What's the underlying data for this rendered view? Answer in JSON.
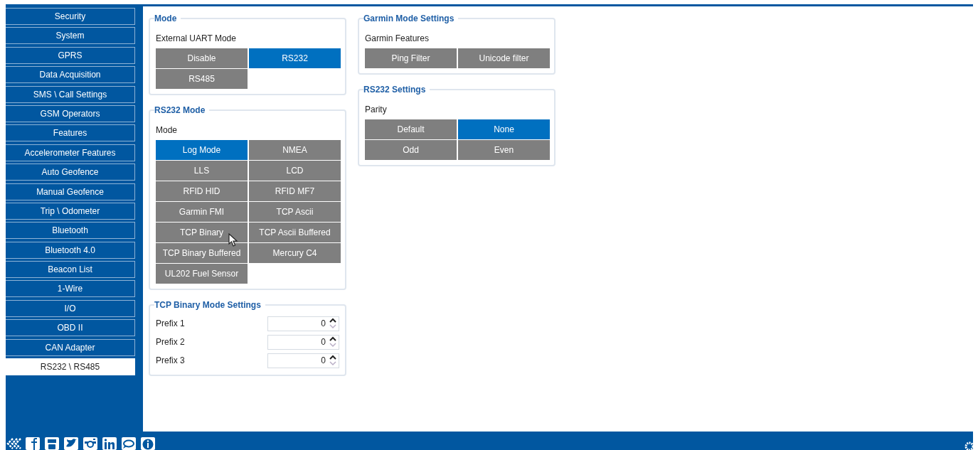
{
  "sidebar": {
    "items": [
      {
        "label": "Security",
        "selected": false
      },
      {
        "label": "System",
        "selected": false
      },
      {
        "label": "GPRS",
        "selected": false
      },
      {
        "label": "Data Acquisition",
        "selected": false
      },
      {
        "label": "SMS \\ Call Settings",
        "selected": false
      },
      {
        "label": "GSM Operators",
        "selected": false
      },
      {
        "label": "Features",
        "selected": false
      },
      {
        "label": "Accelerometer Features",
        "selected": false
      },
      {
        "label": "Auto Geofence",
        "selected": false
      },
      {
        "label": "Manual Geofence",
        "selected": false
      },
      {
        "label": "Trip \\ Odometer",
        "selected": false
      },
      {
        "label": "Bluetooth",
        "selected": false
      },
      {
        "label": "Bluetooth 4.0",
        "selected": false
      },
      {
        "label": "Beacon List",
        "selected": false
      },
      {
        "label": "1-Wire",
        "selected": false
      },
      {
        "label": "I/O",
        "selected": false
      },
      {
        "label": "OBD II",
        "selected": false
      },
      {
        "label": "CAN Adapter",
        "selected": false
      },
      {
        "label": "RS232 \\ RS485",
        "selected": true
      }
    ]
  },
  "left_column": [
    {
      "kind": "options",
      "title": "Mode",
      "label": "External UART Mode",
      "options": [
        {
          "label": "Disable",
          "selected": false
        },
        {
          "label": "RS232",
          "selected": true
        },
        {
          "label": "RS485",
          "selected": false
        }
      ]
    },
    {
      "kind": "options",
      "title": "RS232 Mode",
      "label": "Mode",
      "options": [
        {
          "label": "Log Mode",
          "selected": true
        },
        {
          "label": "NMEA",
          "selected": false
        },
        {
          "label": "LLS",
          "selected": false
        },
        {
          "label": "LCD",
          "selected": false
        },
        {
          "label": "RFID HID",
          "selected": false
        },
        {
          "label": "RFID MF7",
          "selected": false
        },
        {
          "label": "Garmin FMI",
          "selected": false
        },
        {
          "label": "TCP Ascii",
          "selected": false
        },
        {
          "label": "TCP Binary",
          "selected": false
        },
        {
          "label": "TCP Ascii Buffered",
          "selected": false
        },
        {
          "label": "TCP Binary Buffered",
          "selected": false
        },
        {
          "label": "Mercury C4",
          "selected": false
        },
        {
          "label": "UL202 Fuel Sensor",
          "selected": false
        }
      ]
    },
    {
      "kind": "numbers",
      "title": "TCP Binary Mode Settings",
      "fields": [
        {
          "label": "Prefix 1",
          "value": "0"
        },
        {
          "label": "Prefix 2",
          "value": "0"
        },
        {
          "label": "Prefix 3",
          "value": "0"
        }
      ]
    }
  ],
  "right_column": [
    {
      "kind": "options",
      "title": "Garmin Mode Settings",
      "label": "Garmin Features",
      "options": [
        {
          "label": "Ping Filter",
          "selected": false
        },
        {
          "label": "Unicode filter",
          "selected": false
        }
      ]
    },
    {
      "kind": "options",
      "title": "RS232 Settings",
      "label": "Parity",
      "options": [
        {
          "label": "Default",
          "selected": false
        },
        {
          "label": "None",
          "selected": true
        },
        {
          "label": "Odd",
          "selected": false
        },
        {
          "label": "Even",
          "selected": false
        }
      ]
    }
  ]
}
